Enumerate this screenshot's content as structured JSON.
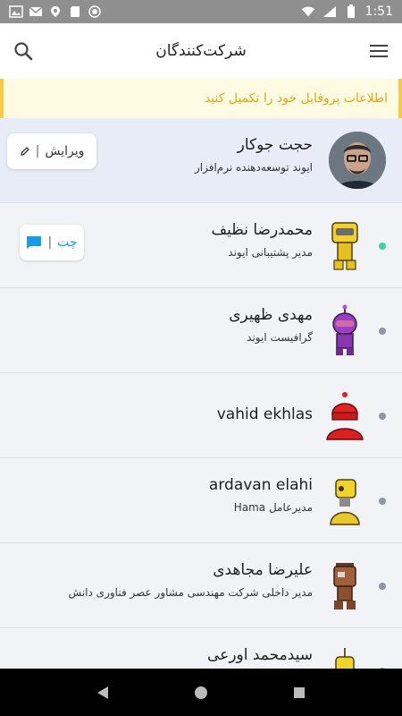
{
  "status_bar": {
    "time": "1:51"
  },
  "app_bar": {
    "title": "شرکت‌کنندگان"
  },
  "banner": {
    "text": "اطلاعات پروفایل خود را تکمیل کنید"
  },
  "edit_button": {
    "label": "ویرایش"
  },
  "chat_button": {
    "label": "چت"
  },
  "participants": [
    {
      "name": "حجت جوکار",
      "role": "ایوند توسعه‌دهنده نرم‌افزار"
    },
    {
      "name": "محمدرضا نظیف",
      "role": "مدیر پشتیبانی ایوند"
    },
    {
      "name": "مهدی ظهیری",
      "role": "گرافیست ایوند"
    },
    {
      "name": "vahid ekhlas",
      "role": ""
    },
    {
      "name": "ardavan elahi",
      "role": "مدیرعامل Hama"
    },
    {
      "name": "علیرضا مجاهدی",
      "role": "مدیر داخلی  شرکت مهندسی مشاور عصر فناوری دانش"
    },
    {
      "name": "سیدمحمد اورعی",
      "role": ""
    }
  ],
  "colors": {
    "online": "#3fd2a0",
    "offline": "#8e96a8",
    "accent": "#1b9be0",
    "banner_text": "#e0a81c"
  }
}
